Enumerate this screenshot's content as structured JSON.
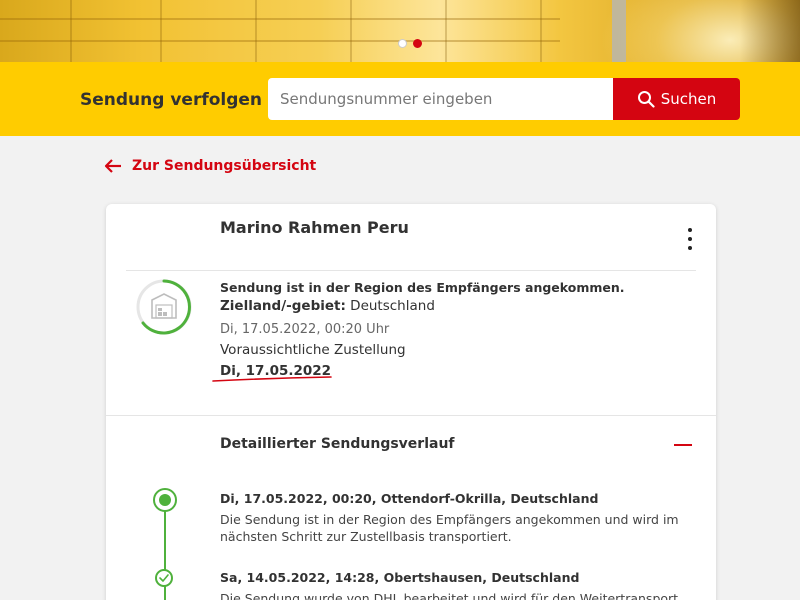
{
  "hero": {
    "slides": 2,
    "active_slide": 2
  },
  "tracking": {
    "title": "Sendung verfolgen",
    "placeholder": "Sendungsnummer eingeben",
    "button_label": "Suchen"
  },
  "nav": {
    "back_label": "Zur Sendungsübersicht"
  },
  "shipment": {
    "title": "Marino Rahmen Peru",
    "status_headline": "Sendung ist in der Region des Empfängers angekommen.",
    "destination_label": "Zielland/-gebiet:",
    "destination_value": "Deutschland",
    "timestamp": "Di, 17.05.2022, 00:20 Uhr",
    "expected_label": "Voraussichtliche Zustellung",
    "expected_date": "Di, 17.05.2022"
  },
  "history": {
    "title": "Detaillierter Sendungsverlauf",
    "events": [
      {
        "heading": "Di, 17.05.2022, 00:20, Ottendorf-Okrilla, Deutschland",
        "description": "Die Sendung ist in der Region des Empfängers angekommen und wird im nächsten Schritt zur Zustellbasis transportiert."
      },
      {
        "heading": "Sa, 14.05.2022, 14:28, Obertshausen, Deutschland",
        "description": "Die Sendung wurde von DHL bearbeitet und wird für den Weitertransport in die Region des Empfängers vorbereitet."
      }
    ]
  },
  "colors": {
    "brand_yellow": "#ffcc00",
    "brand_red": "#d40511",
    "status_green": "#4fb13c"
  }
}
